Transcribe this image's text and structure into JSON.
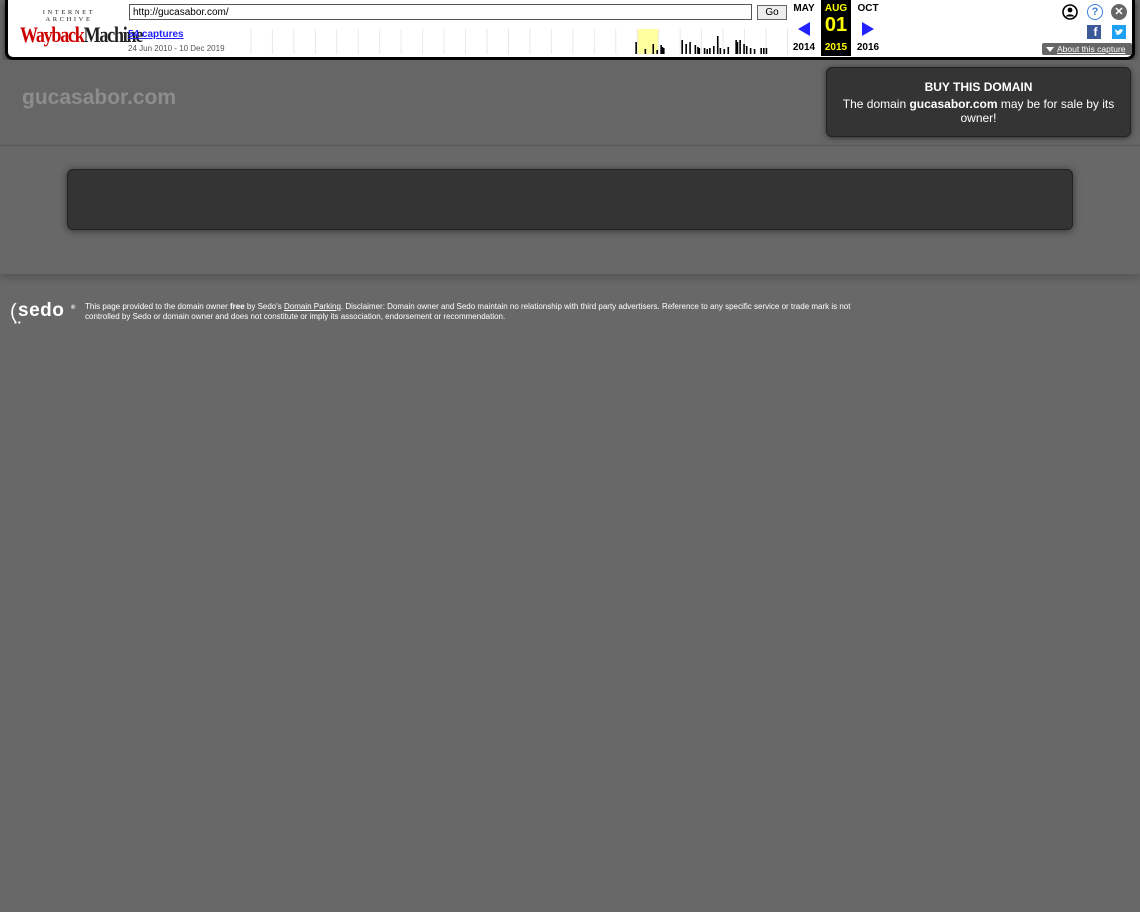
{
  "wayback": {
    "logo_top": "INTERNET ARCHIVE",
    "logo_main_a": "Wayback",
    "logo_main_b": "Machine",
    "url_value": "http://gucasabor.com/",
    "go_label": "Go",
    "captures_link": "54 captures",
    "date_range": "24 Jun 2010 - 10 Dec 2019",
    "calendar": {
      "prev_month": "MAY",
      "prev_year": "2014",
      "current_month": "AUG",
      "current_day": "01",
      "current_year": "2015",
      "next_month": "OCT",
      "next_year": "2016"
    },
    "about_label": "About this capture",
    "sparkline_heights": [
      0,
      0,
      0,
      0,
      0,
      0,
      0,
      0,
      0,
      0,
      0,
      0,
      0,
      0,
      0,
      0,
      0,
      0,
      0,
      0,
      0,
      0,
      0,
      0,
      0,
      0,
      0,
      0,
      0,
      0,
      0,
      0,
      0,
      0,
      0,
      0,
      0,
      0,
      0,
      0,
      0,
      0,
      0,
      0,
      0,
      0,
      0,
      0,
      0,
      0,
      0,
      0,
      0,
      0,
      0,
      0,
      0,
      0,
      0,
      0,
      0,
      0,
      0,
      0,
      0,
      0,
      0,
      0,
      0,
      0,
      0,
      0,
      0,
      0,
      0,
      0,
      0,
      0,
      0,
      0,
      0,
      0,
      0,
      0,
      0,
      0,
      0,
      0,
      0,
      0,
      0,
      0,
      0,
      0,
      0,
      0,
      0,
      0,
      0,
      0,
      0,
      0,
      0,
      0,
      0,
      0,
      0,
      0,
      0,
      0,
      0,
      0,
      0,
      0,
      0,
      0,
      0,
      0,
      0,
      0,
      0,
      0,
      0,
      0,
      0,
      0,
      0,
      0,
      0,
      0,
      0,
      0,
      0,
      0,
      0,
      0,
      0,
      0,
      0,
      0,
      0,
      0,
      0,
      0,
      0,
      0,
      0,
      0,
      0,
      0,
      0,
      0,
      0,
      0,
      0,
      0,
      0,
      0,
      0,
      0,
      0,
      0,
      0,
      0,
      0,
      0,
      0,
      0,
      0,
      0,
      0,
      0,
      0,
      0,
      0,
      0,
      0,
      0,
      0,
      0,
      0,
      0,
      0,
      0,
      0,
      0,
      0,
      0,
      0,
      0,
      0,
      0,
      0,
      0,
      0,
      0,
      0,
      0,
      0,
      0,
      0,
      0,
      0,
      0,
      0,
      0,
      0,
      0,
      0,
      0,
      0,
      0,
      0,
      0,
      0,
      0,
      0,
      0,
      0,
      0,
      0,
      0,
      0,
      0,
      0,
      0,
      0,
      0,
      0,
      0,
      0,
      0,
      0,
      0,
      0,
      0,
      0,
      0,
      0,
      0,
      0,
      0,
      0,
      0,
      0,
      0,
      0,
      0,
      0,
      0,
      0,
      0,
      0,
      0,
      0,
      0,
      0,
      0,
      0,
      0,
      0,
      0,
      0,
      0,
      0,
      0,
      0,
      0,
      0,
      0,
      0,
      0,
      0,
      0,
      0,
      0,
      0,
      0,
      0,
      0,
      0,
      0,
      0,
      0,
      0,
      0,
      0,
      0,
      0,
      0,
      0,
      0,
      0,
      0,
      0,
      0,
      0,
      0,
      0,
      0,
      0,
      0,
      0,
      0,
      0,
      0,
      0,
      0,
      12,
      0,
      0,
      0,
      0,
      0,
      0,
      5,
      0,
      0,
      0,
      0,
      0,
      10,
      0,
      0,
      4,
      0,
      0,
      9,
      7,
      6,
      0,
      0,
      0,
      0,
      0,
      0,
      0,
      0,
      0,
      0,
      0,
      0,
      0,
      14,
      0,
      0,
      10,
      0,
      0,
      12,
      0,
      0,
      0,
      9,
      0,
      7,
      6,
      0,
      0,
      0,
      6,
      0,
      5,
      0,
      6,
      0,
      0,
      8,
      0,
      0,
      18,
      0,
      6,
      0,
      0,
      5,
      0,
      0,
      7,
      0,
      0,
      0,
      0,
      0,
      14,
      12,
      0,
      14,
      0,
      0,
      10,
      0,
      8,
      0,
      0,
      6,
      0,
      0,
      5,
      0,
      0,
      0,
      0,
      6,
      0,
      6,
      0,
      6,
      0,
      0,
      0,
      0,
      0,
      0,
      0,
      0,
      0,
      0,
      0,
      0,
      0,
      0,
      0,
      0
    ],
    "sparkline_highlight_month": 19,
    "sparkline_current_index": 401,
    "colors": {
      "link": "#2222ff",
      "calendar_bg": "#000000",
      "calendar_fg": "#ffff00",
      "highlight": "#ffffa0",
      "current_capture": "#ff0000"
    }
  },
  "page": {
    "domain_title": "gucasabor.com",
    "buy_box": {
      "title": "BUY THIS DOMAIN",
      "text_before": "The domain ",
      "domain_bold": "gucasabor.com",
      "text_after": " may be for sale by its owner!"
    },
    "footer": {
      "logo_text": "sedo",
      "disclaimer_1": "This page provided to the domain owner ",
      "disclaimer_free": "free",
      "disclaimer_2": " by Sedo's ",
      "disclaimer_link": "Domain Parking",
      "disclaimer_3": ". Disclaimer: Domain owner and Sedo maintain no relationship with third party advertisers. Reference to any specific service or trade mark is not controlled by Sedo or domain owner and does not constitute or imply its association, endorsement or recommendation."
    },
    "colors": {
      "background": "#686868",
      "panel": "#343434",
      "title_text": "#8d8d8d"
    }
  }
}
